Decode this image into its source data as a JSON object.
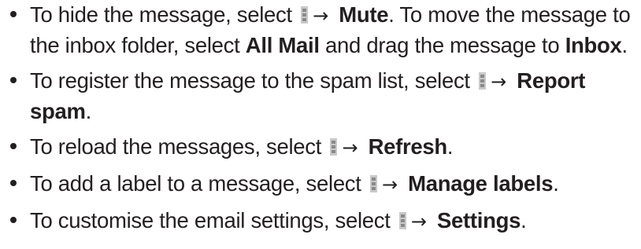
{
  "items": [
    {
      "parts": [
        {
          "t": "To hide the message, select "
        },
        {
          "icon": "menu-icon"
        },
        {
          "t": "→ ",
          "arrow": true
        },
        {
          "t": "Mute",
          "b": true
        },
        {
          "t": ". To move the message to the inbox folder, select "
        },
        {
          "t": "All Mail",
          "b": true
        },
        {
          "t": " and drag the message to "
        },
        {
          "t": "Inbox",
          "b": true
        },
        {
          "t": "."
        }
      ]
    },
    {
      "parts": [
        {
          "t": "To register the message to the spam list, select "
        },
        {
          "icon": "menu-icon"
        },
        {
          "t": "→ ",
          "arrow": true
        },
        {
          "t": "Report spam",
          "b": true
        },
        {
          "t": "."
        }
      ]
    },
    {
      "parts": [
        {
          "t": "To reload the messages, select "
        },
        {
          "icon": "menu-icon"
        },
        {
          "t": "→ ",
          "arrow": true
        },
        {
          "t": "Refresh",
          "b": true
        },
        {
          "t": "."
        }
      ]
    },
    {
      "parts": [
        {
          "t": "To add a label to a message, select "
        },
        {
          "icon": "menu-icon"
        },
        {
          "t": "→ ",
          "arrow": true
        },
        {
          "t": "Manage labels",
          "b": true
        },
        {
          "t": "."
        }
      ]
    },
    {
      "parts": [
        {
          "t": "To customise the email settings, select "
        },
        {
          "icon": "menu-icon"
        },
        {
          "t": "→ ",
          "arrow": true
        },
        {
          "t": "Settings",
          "b": true
        },
        {
          "t": "."
        }
      ]
    }
  ]
}
